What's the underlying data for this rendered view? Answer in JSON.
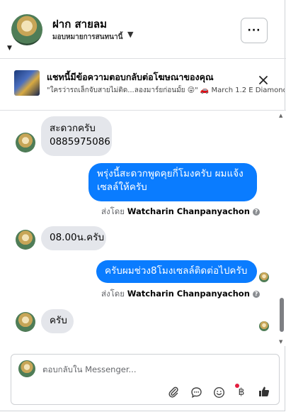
{
  "header": {
    "name": "ฝาก สายลม",
    "assign_label": "มอบหมายการสนทนานี้"
  },
  "ad_banner": {
    "title": "แชทนี้มีข้อความตอบกลับต่อโฆษณาของคุณ",
    "preview": "\"ใครว่ารถเล็กจับสายไม่ติด...ลองมาร์ยก่อนมั้ย 😜\" 🚗 March 1.2 E Diamond..."
  },
  "messages": [
    {
      "direction": "in",
      "lines": [
        "สะดวกครับ",
        "0885975086"
      ]
    },
    {
      "direction": "out",
      "lines": [
        "พรุ่งนี้สะดวกพูดคุยกี่โมงครับ ผมแจ้ง",
        "เซลล์ให้ครับ"
      ]
    },
    {
      "direction": "sent_by",
      "prefix": "ส่งโดย",
      "name": "Watcharin Chanpanyachon"
    },
    {
      "direction": "in",
      "lines": [
        "08.00น.ครับ"
      ]
    },
    {
      "direction": "out",
      "lines": [
        "ครับผมช่วง8โมงเซลล์ติดต่อไปครับ"
      ]
    },
    {
      "direction": "sent_by",
      "prefix": "ส่งโดย",
      "name": "Watcharin Chanpanyachon"
    },
    {
      "direction": "in",
      "lines": [
        "ครับ"
      ]
    }
  ],
  "composer": {
    "placeholder": "ตอบกลับใน Messenger...",
    "baht_symbol": "฿"
  },
  "icons": {
    "more": "more-horizontal-icon",
    "close": "close-icon",
    "attach": "paperclip-icon",
    "saved_replies": "chat-bubble-icon",
    "emoji": "emoji-icon",
    "payment": "baht-icon",
    "like": "thumbs-up-icon"
  },
  "colors": {
    "outgoing_bubble": "#0a7cff",
    "incoming_bubble": "#e4e6eb",
    "notification_dot": "#e41e3f"
  }
}
